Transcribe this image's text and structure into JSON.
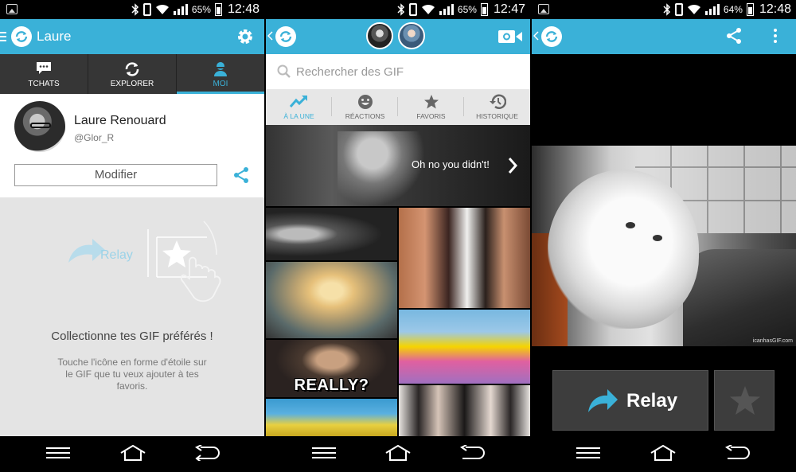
{
  "status_bars": [
    {
      "battery": "65%",
      "time": "12:48"
    },
    {
      "battery": "65%",
      "time": "12:47"
    },
    {
      "battery": "64%",
      "time": "12:48"
    }
  ],
  "profile_screen": {
    "title": "Laure",
    "tabs": [
      {
        "label": "TCHATS",
        "icon": "chat-icon"
      },
      {
        "label": "EXPLORER",
        "icon": "refresh-icon"
      },
      {
        "label": "MOI",
        "icon": "person-icon",
        "active": true
      }
    ],
    "name": "Laure Renouard",
    "handle": "@Glor_R",
    "modify_label": "Modifier",
    "illustration_relay_label": "Relay",
    "empty_title": "Collectionne tes GIF préférés !",
    "empty_description": "Touche l'icône en forme d'étoile sur le GIF que tu veux ajouter à tes favoris."
  },
  "browse_screen": {
    "search_placeholder": "Rechercher des GIF",
    "tabs": [
      {
        "label": "À LA UNE",
        "icon": "trending-icon",
        "active": true
      },
      {
        "label": "RÉACTIONS",
        "icon": "smiley-icon"
      },
      {
        "label": "FAVORIS",
        "icon": "star-icon"
      },
      {
        "label": "HISTORIQUE",
        "icon": "history-icon"
      }
    ],
    "featured_caption": "Oh no you didn't!",
    "gif_caption_really": "REALLY?"
  },
  "viewer_screen": {
    "watermark": "icanhasGIF.com",
    "relay_label": "Relay"
  },
  "colors": {
    "accent": "#3ab1d8",
    "dark_tab": "#363636"
  }
}
